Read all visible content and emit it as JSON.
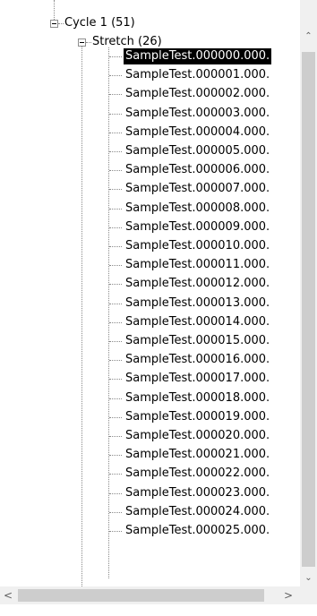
{
  "tree": {
    "nodes": [
      {
        "label": "Cycle 1 (51)",
        "level": 0,
        "expanded": true
      },
      {
        "label": "Stretch (26)",
        "level": 1,
        "expanded": true
      }
    ],
    "leaves": [
      "SampleTest.000000.000.",
      "SampleTest.000001.000.",
      "SampleTest.000002.000.",
      "SampleTest.000003.000.",
      "SampleTest.000004.000.",
      "SampleTest.000005.000.",
      "SampleTest.000006.000.",
      "SampleTest.000007.000.",
      "SampleTest.000008.000.",
      "SampleTest.000009.000.",
      "SampleTest.000010.000.",
      "SampleTest.000011.000.",
      "SampleTest.000012.000.",
      "SampleTest.000013.000.",
      "SampleTest.000014.000.",
      "SampleTest.000015.000.",
      "SampleTest.000016.000.",
      "SampleTest.000017.000.",
      "SampleTest.000018.000.",
      "SampleTest.000019.000.",
      "SampleTest.000020.000.",
      "SampleTest.000021.000.",
      "SampleTest.000022.000.",
      "SampleTest.000023.000.",
      "SampleTest.000024.000.",
      "SampleTest.000025.000."
    ],
    "selected_index": 0
  },
  "scrollbars": {
    "up_icon": "chevron-up-icon",
    "down_icon": "chevron-down-icon",
    "left_icon": "chevron-left-icon",
    "right_icon": "chevron-right-icon"
  },
  "colors": {
    "selection_bg": "#000000",
    "selection_fg": "#ffffff",
    "scrollbar_track": "#f0f0f0",
    "scrollbar_thumb": "#cdcdcd",
    "tree_lines": "#8a8a8a"
  }
}
